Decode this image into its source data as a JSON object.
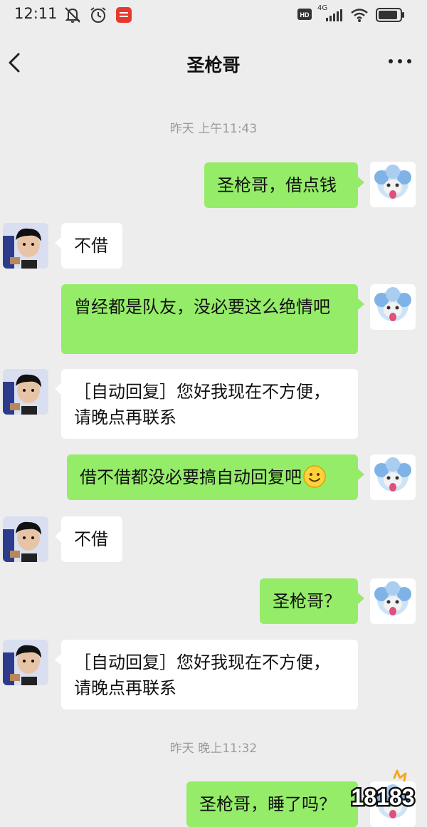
{
  "status_bar": {
    "time": "12:11",
    "hd_label": "HD",
    "network_label": "4G"
  },
  "header": {
    "title": "圣枪哥"
  },
  "messages": [
    {
      "type": "timestamp",
      "text": "昨天 上午11:43"
    },
    {
      "type": "message",
      "side": "out",
      "text": "圣枪哥，借点钱"
    },
    {
      "type": "message",
      "side": "in",
      "text": "不借"
    },
    {
      "type": "message",
      "side": "out",
      "text": "曾经都是队友，没必要这么绝情吧"
    },
    {
      "type": "message",
      "side": "in",
      "text": "［自动回复］您好我现在不方便，请晚点再联系"
    },
    {
      "type": "message",
      "side": "out",
      "text": "借不借都没必要搞自动回复吧",
      "emoji": "smile"
    },
    {
      "type": "message",
      "side": "in",
      "text": "不借"
    },
    {
      "type": "message",
      "side": "out",
      "text": "圣枪哥？"
    },
    {
      "type": "message",
      "side": "in",
      "text": "［自动回复］您好我现在不方便，请晚点再联系"
    },
    {
      "type": "timestamp",
      "text": "昨天 晚上11:32"
    },
    {
      "type": "message",
      "side": "out",
      "text": "圣枪哥，睡了吗？"
    }
  ],
  "watermark": {
    "text": "18183"
  },
  "icons": {
    "back": "chevron-left-icon",
    "more": "more-dots-icon",
    "mute": "mute-bell-icon",
    "alarm": "alarm-clock-icon",
    "wifi": "wifi-icon",
    "battery": "battery-icon",
    "signal": "signal-icon"
  },
  "colors": {
    "background": "#ededed",
    "outgoing_bubble": "#95ec69",
    "incoming_bubble": "#ffffff",
    "timestamp_text": "#9a9a9a",
    "watermark_accent": "#f5a623"
  }
}
